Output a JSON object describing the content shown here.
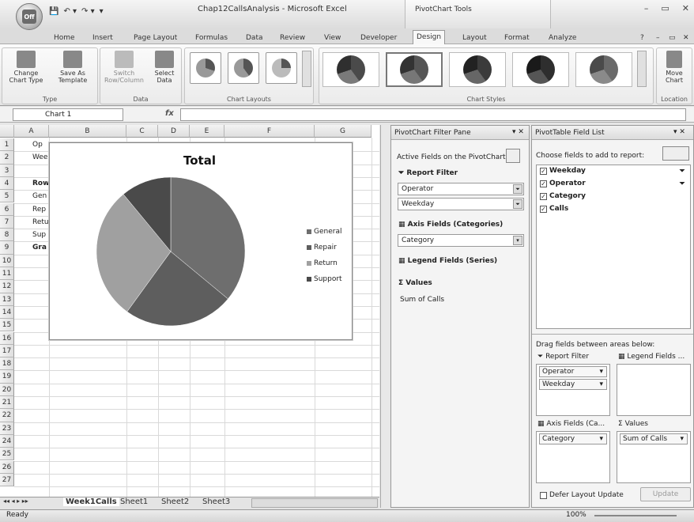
{
  "window": {
    "title": "Chap12CallsAnalysis - Microsoft Excel",
    "contextual_group": "PivotChart Tools",
    "office_logo": "Off",
    "qat_undo": "↶ ▾",
    "qat_redo": "↷ ▾",
    "qat_more": "▾",
    "controls": [
      "–",
      "▭",
      "✕"
    ]
  },
  "ribbon_tabs": [
    "Home",
    "Insert",
    "Page Layout",
    "Formulas",
    "Data",
    "Review",
    "View",
    "Developer",
    "Design",
    "Layout",
    "Format",
    "Analyze"
  ],
  "ribbon_right": {
    "help": "?",
    "minimize": "–",
    "restore": "▭",
    "close": "✕"
  },
  "ribbon": {
    "type_group": {
      "label": "Type",
      "change": "Change\nChart Type",
      "save": "Save As\nTemplate"
    },
    "data_group": {
      "label": "Data",
      "switch": "Switch\nRow/Column",
      "select": "Select\nData"
    },
    "layouts_group": {
      "label": "Chart Layouts"
    },
    "styles_group": {
      "label": "Chart Styles"
    },
    "location_group": {
      "label": "Location",
      "move": "Move\nChart"
    }
  },
  "formula_bar": {
    "name_box": "Chart 1",
    "fx": "fx",
    "formula": ""
  },
  "columns": [
    "A",
    "B",
    "C",
    "D",
    "E",
    "F",
    "G"
  ],
  "rows": [
    "1",
    "2",
    "3",
    "4",
    "5",
    "6",
    "7",
    "8",
    "9",
    "10",
    "11",
    "12",
    "13",
    "14",
    "15",
    "16",
    "17",
    "18",
    "19",
    "20",
    "21",
    "22",
    "23",
    "24",
    "25",
    "26",
    "27"
  ],
  "cells_a": [
    "Op",
    "Wee",
    "",
    "Row",
    "Gen",
    "Rep",
    "Retu",
    "Sup",
    "Gra"
  ],
  "chart": {
    "title": "Total",
    "legend": [
      "General",
      "Repair",
      "Return",
      "Support"
    ]
  },
  "chart_data": {
    "type": "pie",
    "title": "Total",
    "categories": [
      "General",
      "Repair",
      "Return",
      "Support"
    ],
    "values": [
      36,
      24,
      29,
      11
    ],
    "colors": [
      "#6e6e6e",
      "#5e5e5e",
      "#a0a0a0",
      "#4a4a4a"
    ],
    "legend": "right"
  },
  "sheet_tabs": [
    "Week1Calls",
    "Sheet1",
    "Sheet2",
    "Sheet3"
  ],
  "sheet_nav": "◂◂ ◂ ▸ ▸▸",
  "status": {
    "ready": "Ready",
    "zoom": "100%"
  },
  "filter_pane": {
    "title": "PivotChart Filter Pane",
    "active_fields": "Active Fields on the PivotChart",
    "report_filter": "Report Filter",
    "filters": [
      "Operator",
      "Weekday"
    ],
    "axis_fields": "Axis Fields (Categories)",
    "axis_value": "Category",
    "legend_fields": "Legend Fields (Series)",
    "values": "Values",
    "values_item": "Sum of Calls"
  },
  "field_list": {
    "title": "PivotTable Field List",
    "choose": "Choose fields to add to report:",
    "fields": [
      "Weekday",
      "Operator",
      "Category",
      "Calls"
    ],
    "drag": "Drag fields between areas below:",
    "report_filter": "Report Filter",
    "legend_fields": "Legend Fields ...",
    "report_items": [
      "Operator",
      "Weekday"
    ],
    "axis_fields": "Axis Fields (Ca...",
    "values": "Values",
    "axis_item": "Category",
    "values_item": "Sum of Calls",
    "defer": "Defer Layout Update",
    "update": "Update"
  }
}
